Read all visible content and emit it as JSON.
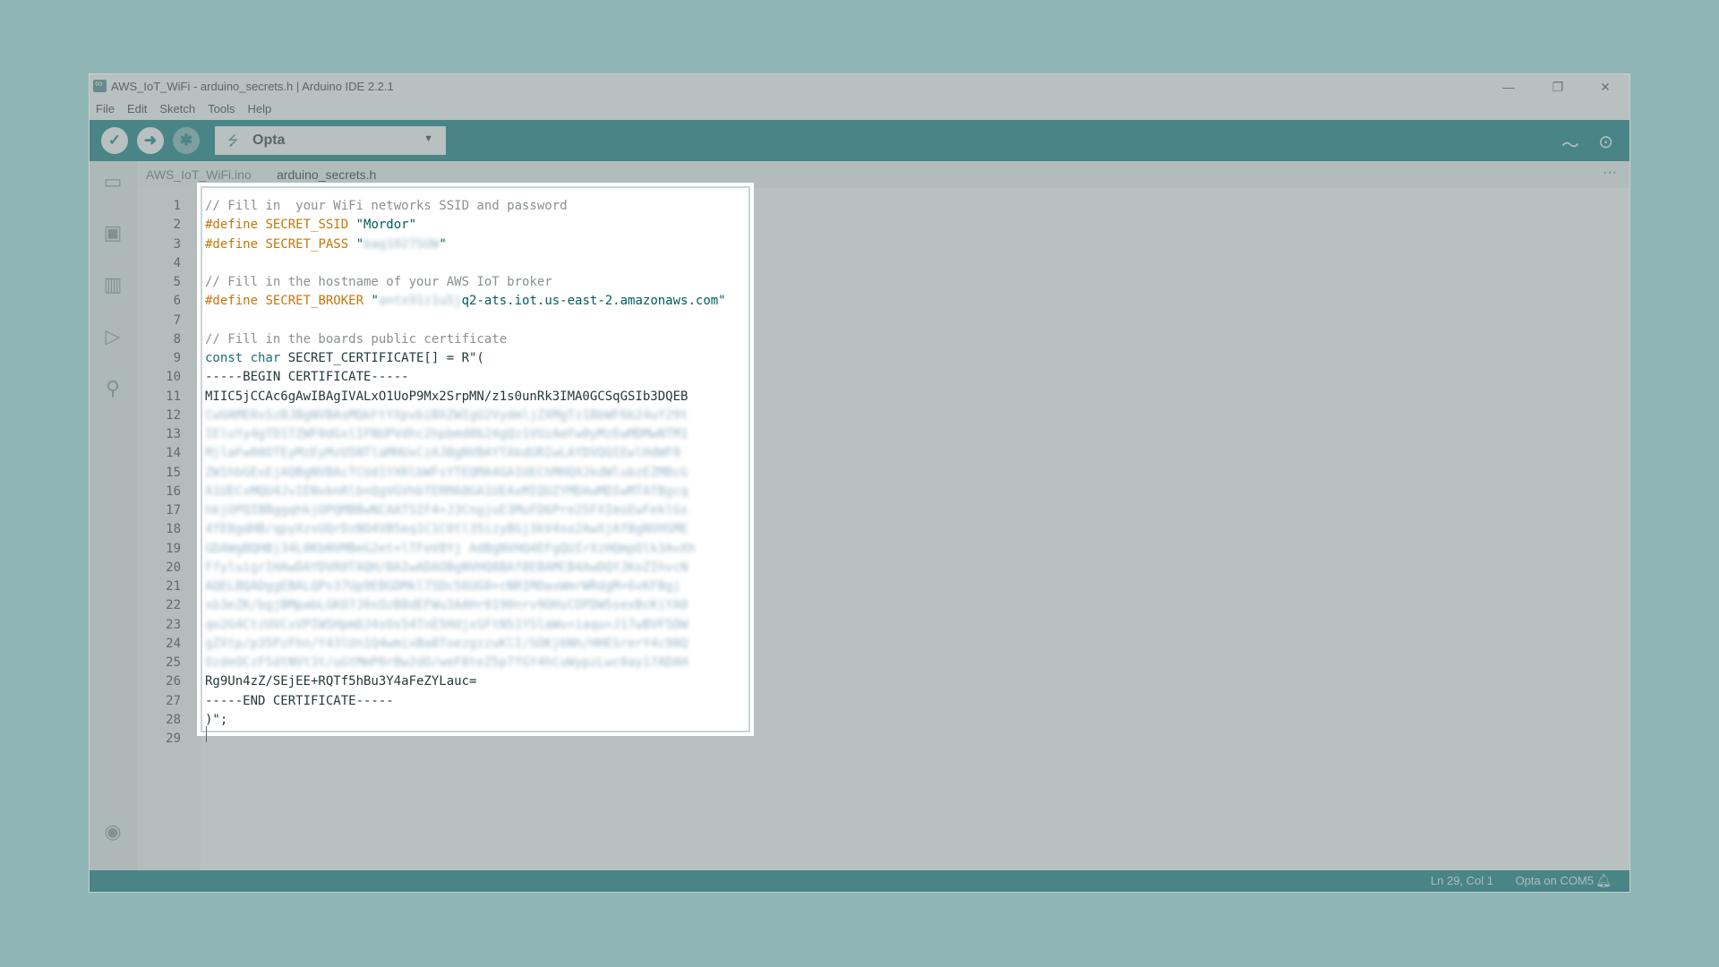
{
  "window": {
    "title": "AWS_IoT_WiFi - arduino_secrets.h | Arduino IDE 2.2.1",
    "minimize_icon": "minimize-icon",
    "restore_icon": "restore-icon",
    "close_icon": "close-icon"
  },
  "menu": [
    "File",
    "Edit",
    "Sketch",
    "Tools",
    "Help"
  ],
  "toolbar": {
    "board": "Opta",
    "verify_icon": "check-icon",
    "upload_icon": "arrow-right-icon",
    "debug_icon": "debug-icon",
    "serial_plotter_icon": "plotter-icon",
    "serial_monitor_icon": "serial-monitor-icon"
  },
  "tabs": [
    {
      "label": "AWS_IoT_WiFi.ino",
      "active": false
    },
    {
      "label": "arduino_secrets.h",
      "active": true
    }
  ],
  "sidebar_icons": [
    "folder-icon",
    "board-manager-icon",
    "library-icon",
    "debug-icon",
    "search-icon",
    "account-icon"
  ],
  "code": {
    "lines": [
      {
        "n": "1",
        "parts": [
          {
            "c": "cmt",
            "t": "// Fill in  your WiFi networks SSID and password"
          }
        ]
      },
      {
        "n": "2",
        "parts": [
          {
            "c": "kw",
            "t": "#define "
          },
          {
            "c": "kw",
            "t": "SECRET_SSID "
          },
          {
            "c": "str",
            "t": "\"Mordor\""
          }
        ]
      },
      {
        "n": "3",
        "parts": [
          {
            "c": "kw",
            "t": "#define "
          },
          {
            "c": "kw",
            "t": "SECRET_PASS "
          },
          {
            "c": "str",
            "t": "\""
          },
          {
            "c": "blur",
            "t": "bag1027SUW"
          },
          {
            "c": "str",
            "t": "\""
          }
        ]
      },
      {
        "n": "4",
        "parts": []
      },
      {
        "n": "5",
        "parts": [
          {
            "c": "cmt",
            "t": "// Fill in the hostname of your AWS IoT broker"
          }
        ]
      },
      {
        "n": "6",
        "parts": [
          {
            "c": "kw",
            "t": "#define "
          },
          {
            "c": "kw",
            "t": "SECRET_BROKER "
          },
          {
            "c": "str",
            "t": "\""
          },
          {
            "c": "blur",
            "t": "antx91z1u5j"
          },
          {
            "c": "str",
            "t": "q2-ats.iot.us-east-2.amazonaws.com\""
          }
        ]
      },
      {
        "n": "7",
        "parts": []
      },
      {
        "n": "8",
        "parts": [
          {
            "c": "cmt",
            "t": "// Fill in the boards public certificate"
          }
        ]
      },
      {
        "n": "9",
        "parts": [
          {
            "c": "id",
            "t": "const char "
          },
          {
            "c": "plain",
            "t": "SECRET_CERTIFICATE[] = R\"("
          }
        ]
      },
      {
        "n": "10",
        "parts": [
          {
            "c": "plain",
            "t": "-----BEGIN CERTIFICATE-----"
          }
        ]
      },
      {
        "n": "11",
        "parts": [
          {
            "c": "plain",
            "t": "MIIC5jCCAc6gAwIBAgIVALxO1UoP9Mx2SrpMN/z1s0unRk3IMA0GCSqGSIb3DQEB"
          }
        ]
      },
      {
        "n": "12",
        "parts": [
          {
            "c": "blur",
            "t": "CwUAME0xSzBJBgNVBAsMQkFtYXpvbiBXZWIgU2VydmljZXMgTz1BbWF6b24uY29t"
          }
        ]
      },
      {
        "n": "13",
        "parts": [
          {
            "c": "blur",
            "t": "IEluYy4gTD1TZWF0dGxlIFNUPVdhc2hpbmd0b24gQz1VUzAeFw0yMzEwMDMwNTM1"
          }
        ]
      },
      {
        "n": "14",
        "parts": [
          {
            "c": "blur",
            "t": "MjlaFw00OTEyMzEyMzU5NTlaMHUxCzAJBgNVBAYTAkdURIwLAYDVQQIEwlHdWF0"
          }
        ]
      },
      {
        "n": "15",
        "parts": [
          {
            "c": "blur",
            "t": "ZW1hbGExEjAQBgNVBAcTCUd1YXRlbWFsYTEQMA4GA1UEChMHQXJkdWlubzEZMBcG"
          }
        ]
      },
      {
        "n": "16",
        "parts": [
          {
            "c": "blur",
            "t": "A1UECxMQU4JvIENvbnRlbnQgVGVhbTERMA8GA1UEAxMIQUZYMDAwMDIwMTATBgcq"
          }
        ]
      },
      {
        "n": "17",
        "parts": [
          {
            "c": "blur",
            "t": "hkjOPQIBBggqhkjOPQMBBwNCAATSIF4+J3CngjuE3MuFD6Pre25FXImsEwFeklGs"
          }
        ]
      },
      {
        "n": "18",
        "parts": [
          {
            "c": "blur",
            "t": "4fE8gdHB/qpyXzsUQrDzNO4VB5eq1C1C0tl35izyBGj3kV4so2AwXjAfBgNVHSME"
          }
        ]
      },
      {
        "n": "19",
        "parts": [
          {
            "c": "blur",
            "t": "GDAWgBQHBj34L0KbNVMBeG2et+lTFoV8Yj AdBgNVHQ4EFgQUIrXzHQmpOlk3AvXh"
          }
        ]
      },
      {
        "n": "20",
        "parts": [
          {
            "c": "blur",
            "t": "FfyluigrIHAwDAYDVR0TAQH/BAIwADAOBgNVHQ8BAf8EBAMCB4AwDQYJKoZIhvcN"
          }
        ]
      },
      {
        "n": "21",
        "parts": [
          {
            "c": "blur",
            "t": "AQELBQADggEBALQPs37Up9EBGDMkl7SDc56UG0+cNRIMOaxWmrWRdgM+6vKFBgj"
          }
        ]
      },
      {
        "n": "22",
        "parts": [
          {
            "c": "blur",
            "t": "xb3eZK/bgjBMpabLGKO7J0sOzB8dEFWu3AAHr0190nrv9OHsCOPDW5sexBcKiYA0"
          }
        ]
      },
      {
        "n": "23",
        "parts": [
          {
            "c": "blur",
            "t": "qo2G4CtzUVCxVPIWSHpmDJ4sOs54TnE5HdjxSFtN51YSlaWu+iaqu+J17wBVF5DW"
          }
        ]
      },
      {
        "n": "24",
        "parts": [
          {
            "c": "blur",
            "t": "gZXtp/p35PzFhn/Y43lUn1Q4wmixBa8ToezgzzuKlI/SOKj6Nh/HHESrerY4c90Q"
          }
        ]
      },
      {
        "n": "25",
        "parts": [
          {
            "c": "blur",
            "t": "OzdeOCzF5dtNVt3t/uGtMmP0rBw2dO/weF8teZ5p7fGY4hCuWypzLwc0ay17ADAH"
          }
        ]
      },
      {
        "n": "26",
        "parts": [
          {
            "c": "plain",
            "t": "Rg9Un4zZ/SEjEE+RQTf5hBu3Y4aFeZYLauc="
          }
        ]
      },
      {
        "n": "27",
        "parts": [
          {
            "c": "plain",
            "t": "-----END CERTIFICATE-----"
          }
        ]
      },
      {
        "n": "28",
        "parts": [
          {
            "c": "plain",
            "t": ")\";"
          }
        ]
      },
      {
        "n": "29",
        "parts": []
      }
    ]
  },
  "status": {
    "position": "Ln 29, Col 1",
    "board": "Opta on COM5",
    "bell_icon": "bell-icon"
  }
}
